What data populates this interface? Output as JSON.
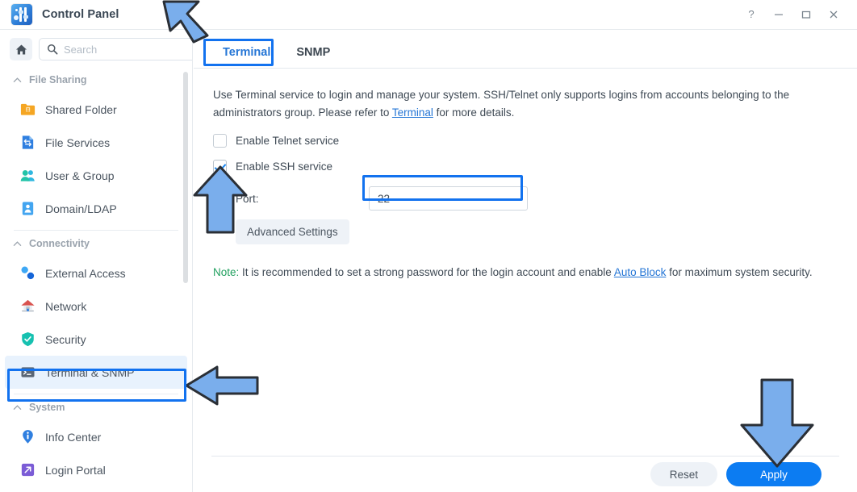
{
  "window": {
    "title": "Control Panel",
    "app_icon": "control-panel-icon",
    "controls": [
      {
        "name": "help-button",
        "glyph": "?"
      },
      {
        "name": "minimize-button",
        "glyph": "–"
      },
      {
        "name": "maximize-button",
        "glyph": "□"
      },
      {
        "name": "close-button",
        "glyph": "✕"
      }
    ]
  },
  "sidebar": {
    "home_icon": "home-icon",
    "search": {
      "value": "",
      "placeholder": "Search",
      "icon": "search-icon"
    },
    "groups": [
      {
        "label": "File Sharing",
        "chevron": "chevron-up-icon",
        "items": [
          {
            "label": "Shared Folder",
            "icon": "shared-folder-icon",
            "selected": false
          },
          {
            "label": "File Services",
            "icon": "file-services-icon",
            "selected": false
          },
          {
            "label": "User & Group",
            "icon": "user-group-icon",
            "selected": false
          },
          {
            "label": "Domain/LDAP",
            "icon": "domain-ldap-icon",
            "selected": false
          }
        ]
      },
      {
        "label": "Connectivity",
        "chevron": "chevron-up-icon",
        "items": [
          {
            "label": "External Access",
            "icon": "external-access-icon",
            "selected": false
          },
          {
            "label": "Network",
            "icon": "network-icon",
            "selected": false
          },
          {
            "label": "Security",
            "icon": "security-shield-icon",
            "selected": false
          },
          {
            "label": "Terminal & SNMP",
            "icon": "terminal-icon",
            "selected": true
          }
        ]
      },
      {
        "label": "System",
        "chevron": "chevron-up-icon",
        "items": [
          {
            "label": "Info Center",
            "icon": "info-center-icon",
            "selected": false
          },
          {
            "label": "Login Portal",
            "icon": "login-portal-icon",
            "selected": false
          }
        ]
      }
    ]
  },
  "main": {
    "tabs": [
      {
        "label": "Terminal",
        "active": true
      },
      {
        "label": "SNMP",
        "active": false
      }
    ],
    "description": {
      "part1": "Use Terminal service to login and manage your system. SSH/Telnet only supports logins from accounts belonging to the administrators group. Please refer to ",
      "link": "Terminal",
      "part2": " for more details."
    },
    "telnet": {
      "label": "Enable Telnet service",
      "checked": false
    },
    "ssh": {
      "label": "Enable SSH service",
      "checked": true
    },
    "port": {
      "label": "Port:",
      "value": "22"
    },
    "advanced_settings_label": "Advanced Settings",
    "note": {
      "label": "Note:",
      "part1": " It is recommended to set a strong password for the login account and enable ",
      "link": "Auto Block",
      "part2": " for maximum system security."
    }
  },
  "footer": {
    "reset_label": "Reset",
    "apply_label": "Apply"
  },
  "annotations": {
    "arrow_color": "#7aaeec",
    "arrow_outline": "#2a2f36",
    "box_color": "#1272ef",
    "items": [
      {
        "name": "arrow-to-terminal-tab",
        "direction": "down-right"
      },
      {
        "name": "arrow-to-ssh-checkbox",
        "direction": "up"
      },
      {
        "name": "arrow-to-terminal-snmp-nav",
        "direction": "left"
      },
      {
        "name": "arrow-to-apply-button",
        "direction": "down"
      },
      {
        "name": "highlight-terminal-tab"
      },
      {
        "name": "highlight-port-field"
      },
      {
        "name": "highlight-terminal-snmp-nav"
      }
    ]
  }
}
